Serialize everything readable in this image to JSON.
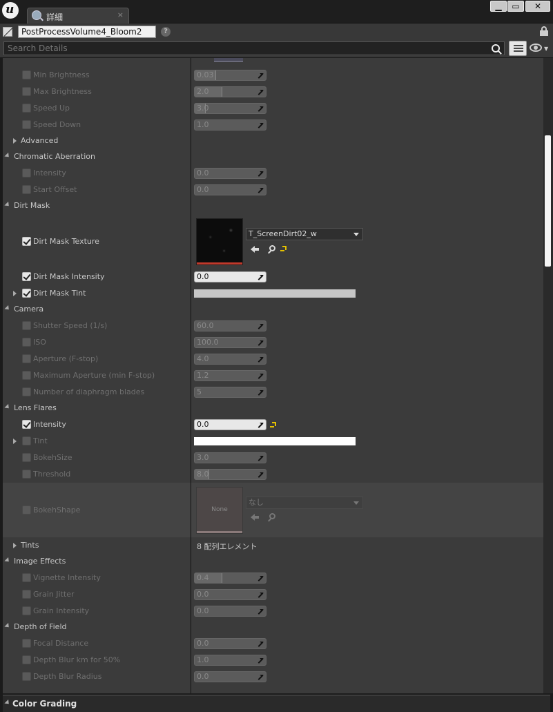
{
  "app": {
    "tab_label": "詳細",
    "tab_close": "×"
  },
  "window_buttons": {
    "minimize": "▁",
    "maximize": "▭",
    "close": "✕"
  },
  "object_name": "PostProcessVolume4_Bloom2",
  "help_glyph": "?",
  "search": {
    "placeholder": "Search Details"
  },
  "properties": {
    "min_brightness": {
      "label": "Min Brightness",
      "value": "0.03",
      "fill": 0.03
    },
    "max_brightness": {
      "label": "Max Brightness",
      "value": "2.0",
      "fill": 0.4
    },
    "speed_up": {
      "label": "Speed Up",
      "value": "3.0",
      "fill": 0.15
    },
    "speed_down": {
      "label": "Speed Down",
      "value": "1.0",
      "fill": 0
    },
    "advanced": {
      "label": "Advanced"
    },
    "chromatic_aberration": {
      "label": "Chromatic Aberration"
    },
    "ca_intensity": {
      "label": "Intensity",
      "value": "0.0"
    },
    "ca_start_offset": {
      "label": "Start Offset",
      "value": "0.0"
    },
    "dirt_mask": {
      "label": "Dirt Mask"
    },
    "dirt_mask_texture": {
      "label": "Dirt Mask Texture",
      "asset": "T_ScreenDirt02_w"
    },
    "dirt_mask_intensity": {
      "label": "Dirt Mask Intensity",
      "value": "0.0"
    },
    "dirt_mask_tint": {
      "label": "Dirt Mask Tint",
      "color": "#c6c6c6"
    },
    "camera": {
      "label": "Camera"
    },
    "shutter_speed": {
      "label": "Shutter Speed (1/s)",
      "value": "60.0"
    },
    "iso": {
      "label": "ISO",
      "value": "100.0"
    },
    "aperture": {
      "label": "Aperture (F-stop)",
      "value": "4.0"
    },
    "max_aperture": {
      "label": "Maximum Aperture (min F-stop)",
      "value": "1.2"
    },
    "diaphragm_blades": {
      "label": "Number of diaphragm blades",
      "value": "5"
    },
    "lens_flares": {
      "label": "Lens Flares"
    },
    "lf_intensity": {
      "label": "Intensity",
      "value": "0.0"
    },
    "lf_tint": {
      "label": "Tint",
      "color": "#ffffff"
    },
    "bokeh_size": {
      "label": "BokehSize",
      "value": "3.0"
    },
    "threshold": {
      "label": "Threshold",
      "value": "8.0",
      "fill": 0.2
    },
    "bokeh_shape": {
      "label": "BokehShape",
      "thumb_text": "None",
      "asset": "なし"
    },
    "tints": {
      "label": "Tints",
      "value": "8 配列エレメント"
    },
    "image_effects": {
      "label": "Image Effects"
    },
    "vignette_intensity": {
      "label": "Vignette Intensity",
      "value": "0.4",
      "fill": 0.4
    },
    "grain_jitter": {
      "label": "Grain Jitter",
      "value": "0.0"
    },
    "grain_intensity": {
      "label": "Grain Intensity",
      "value": "0.0"
    },
    "depth_of_field": {
      "label": "Depth of Field"
    },
    "focal_distance": {
      "label": "Focal Distance",
      "value": "0.0"
    },
    "depth_blur_km": {
      "label": "Depth Blur km for 50%",
      "value": "1.0"
    },
    "depth_blur_radius": {
      "label": "Depth Blur Radius",
      "value": "0.0"
    }
  },
  "footer": {
    "label": "Color Grading"
  },
  "colors": {
    "panel_bg": "#3b3b3b",
    "reset_arrow": "#e5c200",
    "dirt_bar": "#c0392b"
  }
}
